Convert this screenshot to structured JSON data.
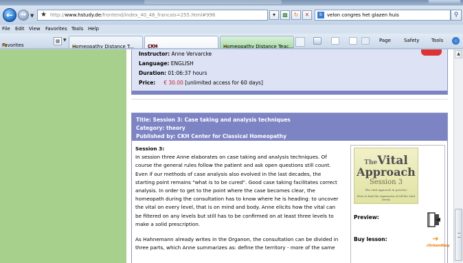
{
  "browser": {
    "url_host": "www.hstudy.de",
    "url_prefix": "http://",
    "url_path": "/frontend/index_40_46_francais=255.html#996",
    "search_text": "velon congres het glazen huis",
    "menu": [
      "File",
      "Edit",
      "View",
      "Favorites",
      "Tools",
      "Help"
    ],
    "favorites_label": "Favorites",
    "tabs": [
      {
        "label": "Homeopathy Distance T...",
        "close": "×"
      },
      {
        "label": "CKH",
        "icon_text": "CKH"
      },
      {
        "label": "Homeopathy Distance Teac..."
      }
    ],
    "commands": [
      "Page",
      "Safety",
      "Tools"
    ]
  },
  "course_info": {
    "instructor_label": "Instructor:",
    "instructor": "Anne Vervarcke",
    "language_label": "Language:",
    "language": "ENGLISH",
    "duration_label": "Duration:",
    "duration": "01:06:37 hours",
    "price_label": "Price:",
    "price": "€ 30.00",
    "price_note": "[unlimited access for 60 days]"
  },
  "session": {
    "title_line": "Title: Session 3: Case taking and analysis techniques",
    "category_line": "Category: theory",
    "publisher_line": "Published by: CKH Center for Classical Homeopathy",
    "name": "Session 3:",
    "paragraph1_lines": [
      "In session three Anne elaborates on case taking and analysis techniques. Of",
      "course the general rules  follow the patient and ask open questions  still count.",
      "Even if our methods of case analysis also evolved in the last decades, the",
      "starting point remains \"what is to be cured\". Good case taking facilitates correct",
      "analysis. In order to get to the point where the case becomes clear, the",
      "homeopath during the consultation has to know where he is heading: to uncover",
      "the vital on every level, that is on mind and body. Anne elicits how the vital can",
      "be filtered on any levels but still has to be confirmed on at least three levels to",
      "make a solid prescription."
    ],
    "paragraph2_lines": [
      "As Hahnemann already writes in the Organon, the consultation can be divided in",
      "three parts, which Anne summarizes as: define the territory - more of the same"
    ],
    "cover": {
      "line1_small": "The",
      "line1_big": "Vital",
      "line2": "Approach",
      "line3": "Session 3",
      "line4": "The vital approach in practice",
      "line5": "How to find the expression of all the vital levels"
    },
    "preview_label": "Preview:",
    "buy_label": "Buy lesson:",
    "buy_badge": "clickandbuy"
  },
  "colors": {
    "sidebar_green": "#a8d08d",
    "header_purple": "#7d84c4",
    "info_bg": "#dde3f5",
    "price_red": "#c41e3a"
  }
}
